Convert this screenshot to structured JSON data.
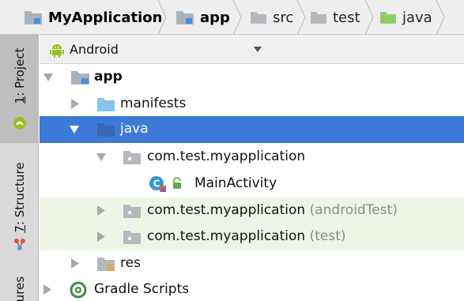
{
  "breadcrumb": {
    "items": [
      {
        "label": "MyApplication",
        "icon": "module-folder-icon",
        "bold": true
      },
      {
        "label": "app",
        "icon": "module-folder-icon",
        "bold": true
      },
      {
        "label": "src",
        "icon": "folder-icon",
        "bold": false
      },
      {
        "label": "test",
        "icon": "folder-icon",
        "bold": false
      },
      {
        "label": "java",
        "icon": "green-folder-icon",
        "bold": false
      }
    ]
  },
  "toolwindows": {
    "project": {
      "number": "1",
      "label": ": Project"
    },
    "structure": {
      "number": "7",
      "label": ": Structure"
    },
    "favorites": {
      "label": "ures"
    }
  },
  "view_selector": {
    "label": "Android",
    "icon": "android-icon"
  },
  "tree": {
    "app": {
      "label": "app"
    },
    "manifests": {
      "label": "manifests"
    },
    "java": {
      "label": "java"
    },
    "pkg_main": {
      "label": "com.test.myapplication"
    },
    "main_activity": {
      "label": "MainActivity"
    },
    "pkg_android_test": {
      "label": "com.test.myapplication",
      "suffix": "(androidTest)"
    },
    "pkg_test": {
      "label": "com.test.myapplication",
      "suffix": "(test)"
    },
    "res": {
      "label": "res"
    },
    "gradle": {
      "label": "Gradle Scripts"
    }
  },
  "colors": {
    "selection": "#3d79d6",
    "test_tint": "#eef5e7",
    "folder_blue": "#87c3ee",
    "folder_gray": "#b4b9bf",
    "folder_green": "#8ecf6b",
    "android_green": "#97c024"
  }
}
